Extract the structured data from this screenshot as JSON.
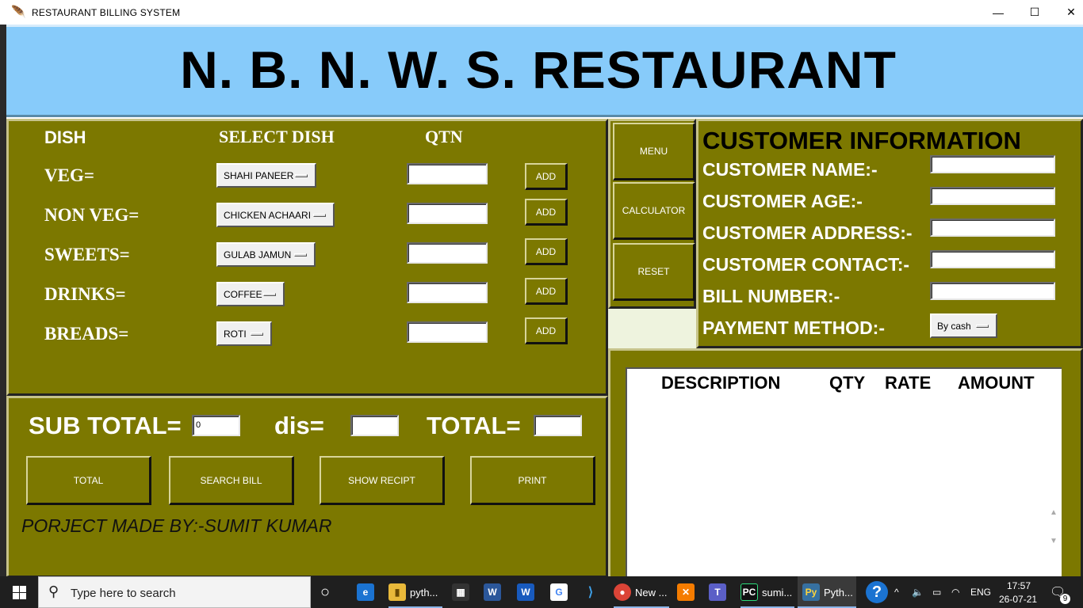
{
  "window": {
    "title": "RESTAURANT  BILLING SYSTEM",
    "minimize": "—",
    "maximize": "☐",
    "close": "✕"
  },
  "header": {
    "title": "N. B. N. W. S. RESTAURANT"
  },
  "order": {
    "col_dish": "DISH",
    "col_select": "SELECT DISH",
    "col_qtn": "QTN",
    "rows": [
      {
        "label": "VEG=",
        "selected": "SHAHI PANEER",
        "qty": "",
        "add": "ADD"
      },
      {
        "label": "NON VEG=",
        "selected": "CHICKEN ACHAARI",
        "qty": "",
        "add": "ADD"
      },
      {
        "label": "SWEETS=",
        "selected": "GULAB JAMUN",
        "qty": "",
        "add": "ADD"
      },
      {
        "label": "DRINKS=",
        "selected": "COFFEE",
        "qty": "",
        "add": "ADD"
      },
      {
        "label": "BREADS=",
        "selected": "ROTI",
        "qty": "",
        "add": "ADD"
      }
    ]
  },
  "totals": {
    "subtotal_label": "SUB TOTAL=",
    "subtotal_value": "0",
    "dis_label": "dis=",
    "dis_value": "",
    "total_label": "TOTAL=",
    "total_value": ""
  },
  "actions": {
    "total": "TOTAL",
    "search_bill": "SEARCH BILL",
    "show_recipt": "SHOW RECIPT",
    "print": "PRINT"
  },
  "credit": "PORJECT MADE BY:-SUMIT KUMAR",
  "side": {
    "menu": "MENU",
    "calculator": "CALCULATOR",
    "reset": "RESET"
  },
  "customer": {
    "heading": "CUSTOMER INFORMATION",
    "name_label": "CUSTOMER NAME:-",
    "age_label": "CUSTOMER AGE:-",
    "address_label": "CUSTOMER ADDRESS:-",
    "contact_label": "CUSTOMER CONTACT:-",
    "bill_label": "BILL NUMBER:-",
    "payment_label": "PAYMENT METHOD:-",
    "payment_selected": "By cash"
  },
  "bill": {
    "description": "DESCRIPTION",
    "qty": "QTY",
    "rate": "RATE",
    "amount": "AMOUNT"
  },
  "taskbar": {
    "search_placeholder": "Type here to search",
    "apps": [
      {
        "name": "pyth..."
      },
      {
        "name": "New ..."
      },
      {
        "name": "sumi..."
      },
      {
        "name": "Pyth..."
      }
    ],
    "language": "ENG",
    "time": "17:57",
    "date": "26-07-21",
    "notifications": "9"
  }
}
